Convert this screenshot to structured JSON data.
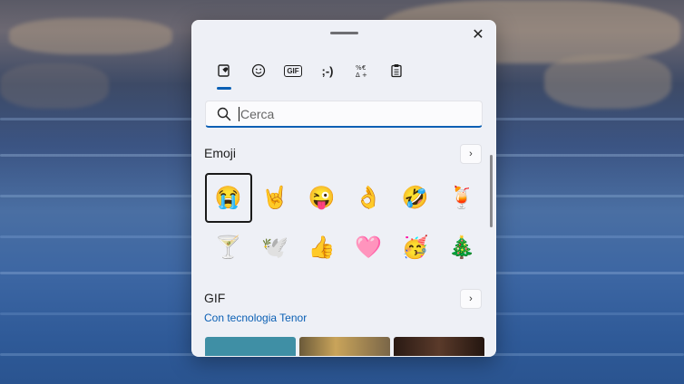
{
  "panel": {
    "tabs": [
      {
        "name": "favorites",
        "label": "",
        "active": true
      },
      {
        "name": "emoji",
        "label": "",
        "active": false
      },
      {
        "name": "gif",
        "label": "GIF",
        "active": false
      },
      {
        "name": "kaomoji",
        "label": ";-)",
        "active": false
      },
      {
        "name": "symbols",
        "label": "",
        "active": false
      },
      {
        "name": "clipboard",
        "label": "",
        "active": false
      }
    ],
    "search": {
      "placeholder": "Cerca",
      "value": ""
    },
    "emoji_section": {
      "title": "Emoji"
    },
    "emojis": [
      "😭",
      "🤘",
      "😜",
      "👌",
      "🤣",
      "🍹",
      "🍸",
      "🕊️",
      "👍",
      "🩷",
      "🥳",
      "🎄"
    ],
    "gif_section": {
      "title": "GIF",
      "attribution": "Con tecnologia Tenor"
    },
    "close_label": "✕",
    "chevron": "›"
  },
  "colors": {
    "accent": "#0a5fb4",
    "panel": "#eef0f6"
  }
}
